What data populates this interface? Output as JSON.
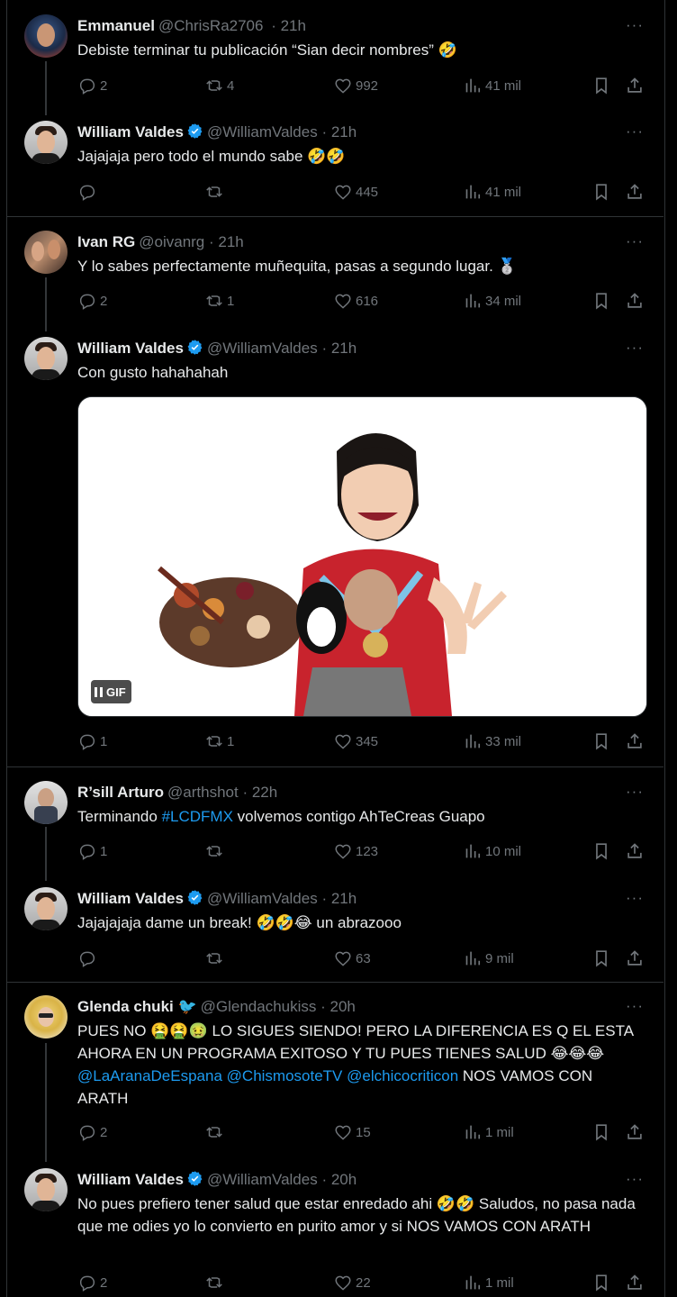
{
  "tweets": [
    {
      "name": "Emmanuel",
      "handle": "@ChrisRa2706",
      "time": "21h",
      "text": "Debiste terminar tu publicación “Sian decir nombres” 🤣",
      "replies": "2",
      "retweets": "4",
      "likes": "992",
      "views": "41 mil",
      "verified": false
    },
    {
      "name": "William Valdes",
      "handle": "@WilliamValdes",
      "time": "21h",
      "text": "Jajajaja pero todo el mundo sabe 🤣🤣",
      "replies": "",
      "retweets": "",
      "likes": "445",
      "views": "41 mil",
      "verified": true
    },
    {
      "name": "Ivan RG",
      "handle": "@oivanrg",
      "time": "21h",
      "text": "Y lo sabes perfectamente muñequita, pasas a segundo lugar. 🥈",
      "replies": "2",
      "retweets": "1",
      "likes": "616",
      "views": "34 mil",
      "verified": false
    },
    {
      "name": "William Valdes",
      "handle": "@WilliamValdes",
      "time": "21h",
      "text": "Con gusto hahahahah",
      "replies": "1",
      "retweets": "1",
      "likes": "345",
      "views": "33 mil",
      "verified": true,
      "gif_label": "GIF"
    },
    {
      "name": "R’sill Arturo",
      "handle": "@arthshot",
      "time": "22h",
      "text_before": "Terminando ",
      "hashtag": "#LCDFMX",
      "text_after": " volvemos contigo AhTeCreas Guapo",
      "replies": "1",
      "retweets": "",
      "likes": "123",
      "views": "10 mil",
      "verified": false
    },
    {
      "name": "William Valdes",
      "handle": "@WilliamValdes",
      "time": "21h",
      "text": "Jajajajaja dame un break! 🤣🤣😂 un abrazooo",
      "replies": "",
      "retweets": "",
      "likes": "63",
      "views": "9 mil",
      "verified": true
    },
    {
      "name": "Glenda chuki 🐦",
      "handle": "@Glendachukiss",
      "time": "20h",
      "text_a": "PUES NO 🤮🤮🤢 LO SIGUES SIENDO! PERO LA DIFERENCIA ES Q EL ESTA AHORA EN UN PROGRAMA EXITOSO Y TU PUES TIENES SALUD 😂😂😂 ",
      "mention1": "@LaAranaDeEspana",
      "mention2": "@ChismosoteTV",
      "mention3": "@elchicocriticon",
      "text_b": " NOS VAMOS CON ARATH",
      "replies": "2",
      "retweets": "",
      "likes": "15",
      "views": "1 mil",
      "verified": false
    },
    {
      "name": "William Valdes",
      "handle": "@WilliamValdes",
      "time": "20h",
      "text": "No pues prefiero tener salud que estar enredado ahi 🤣🤣 Saludos, no pasa nada que me odies yo lo convierto en purito amor y si NOS VAMOS CON ARATH",
      "replies": "2",
      "retweets": "",
      "likes": "22",
      "views": "1 mil",
      "verified": true
    }
  ],
  "colors": {
    "background": "#000000",
    "text": "#e7e9ea",
    "muted": "#71767b",
    "link": "#1d9bf0",
    "verified": "#1d9bf0"
  }
}
